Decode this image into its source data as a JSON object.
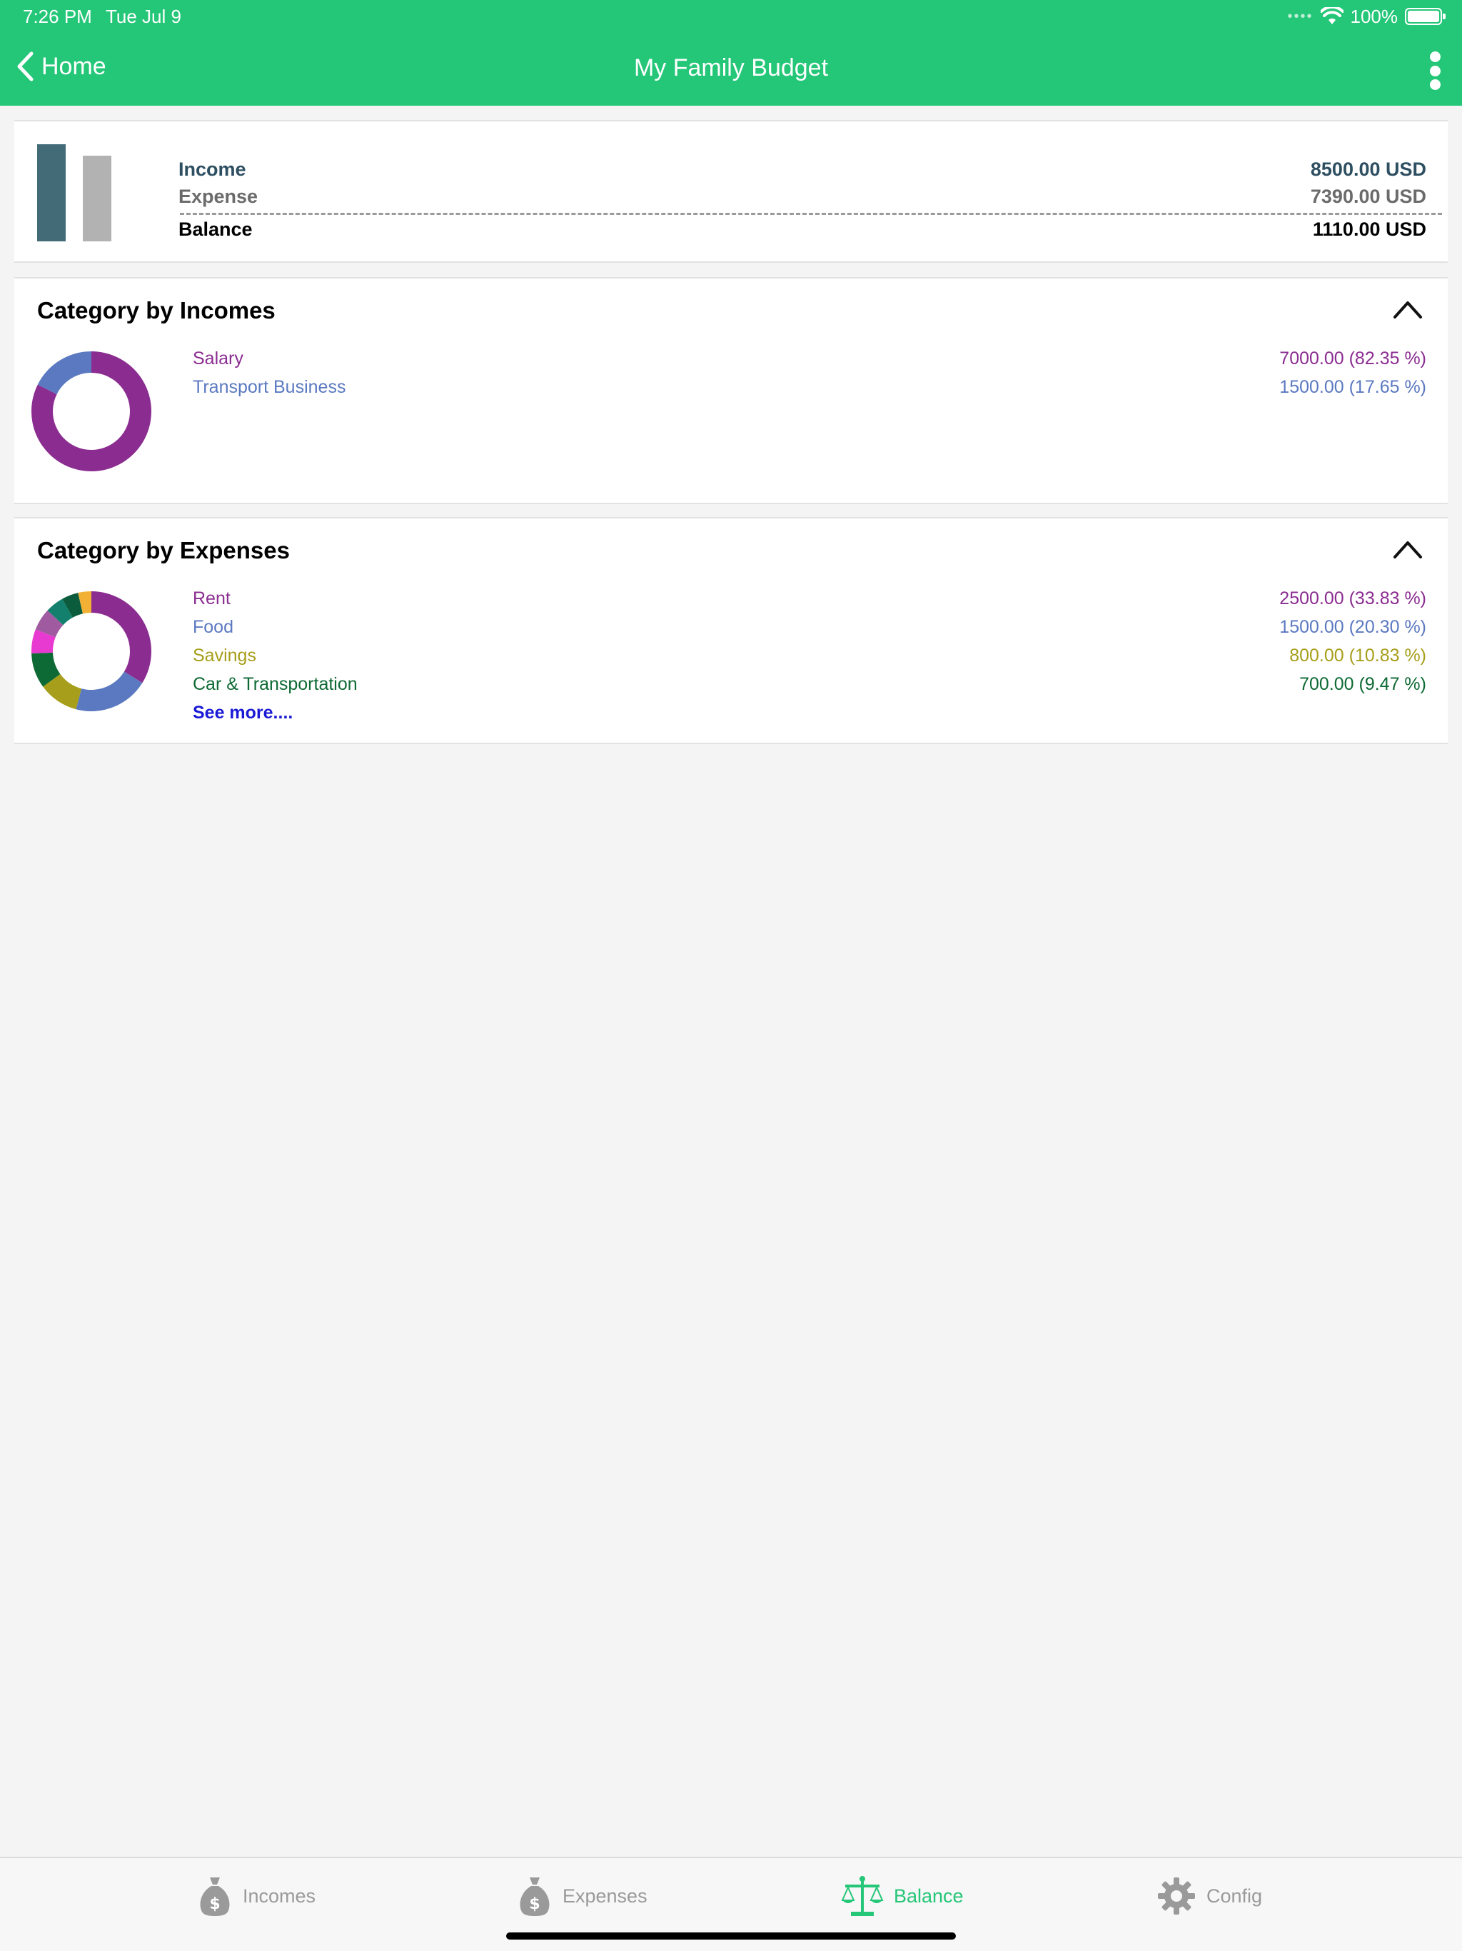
{
  "status_bar": {
    "time": "7:26 PM",
    "date": "Tue Jul 9",
    "battery": "100%"
  },
  "nav": {
    "back_label": "Home",
    "title": "My Family Budget"
  },
  "summary": {
    "income_label": "Income",
    "income_value": "8500.00 USD",
    "expense_label": "Expense",
    "expense_value": "7390.00 USD",
    "balance_label": "Balance",
    "balance_value": "1110.00 USD"
  },
  "incomes": {
    "title": "Category by Incomes",
    "items": [
      {
        "label": "Salary",
        "value": "7000.00 (82.35 %)",
        "color": "#8b2c91"
      },
      {
        "label": "Transport Business",
        "value": "1500.00 (17.65 %)",
        "color": "#5b79c1"
      }
    ]
  },
  "expenses": {
    "title": "Category by Expenses",
    "items": [
      {
        "label": "Rent",
        "value": "2500.00 (33.83 %)",
        "color": "#8b2c91"
      },
      {
        "label": "Food",
        "value": "1500.00 (20.30 %)",
        "color": "#5b79c1"
      },
      {
        "label": "Savings",
        "value": "800.00 (10.83 %)",
        "color": "#a79e1b"
      },
      {
        "label": "Car & Transportation",
        "value": "700.00 (9.47 %)",
        "color": "#0e6a34"
      }
    ],
    "see_more": "See more...."
  },
  "tabs": [
    {
      "label": "Incomes",
      "icon": "money-bag-icon"
    },
    {
      "label": "Expenses",
      "icon": "money-bag-icon"
    },
    {
      "label": "Balance",
      "icon": "scale-icon"
    },
    {
      "label": "Config",
      "icon": "gear-icon"
    }
  ],
  "colors": {
    "brand_green": "#24c677",
    "income_bar": "#436b77",
    "expense_bar": "#b2b2b2"
  },
  "chart_data": [
    {
      "type": "bar",
      "categories": [
        "Income",
        "Expense"
      ],
      "values": [
        8500,
        7390
      ]
    },
    {
      "type": "pie",
      "title": "Category by Incomes",
      "categories": [
        "Salary",
        "Transport Business"
      ],
      "values": [
        82.35,
        17.65
      ],
      "colors": [
        "#8b2c91",
        "#5b79c1"
      ]
    },
    {
      "type": "pie",
      "title": "Category by Expenses",
      "categories": [
        "Rent",
        "Food",
        "Savings",
        "Car & Transportation",
        "",
        "",
        "",
        "",
        ""
      ],
      "values": [
        33.83,
        20.3,
        10.83,
        9.47,
        6.5,
        6.0,
        5.0,
        4.5,
        3.57
      ],
      "colors": [
        "#8b2c91",
        "#5b79c1",
        "#a79e1b",
        "#0e6a34",
        "#e83ad0",
        "#a05aa0",
        "#12806d",
        "#0b5c3c",
        "#f2b134"
      ]
    }
  ]
}
